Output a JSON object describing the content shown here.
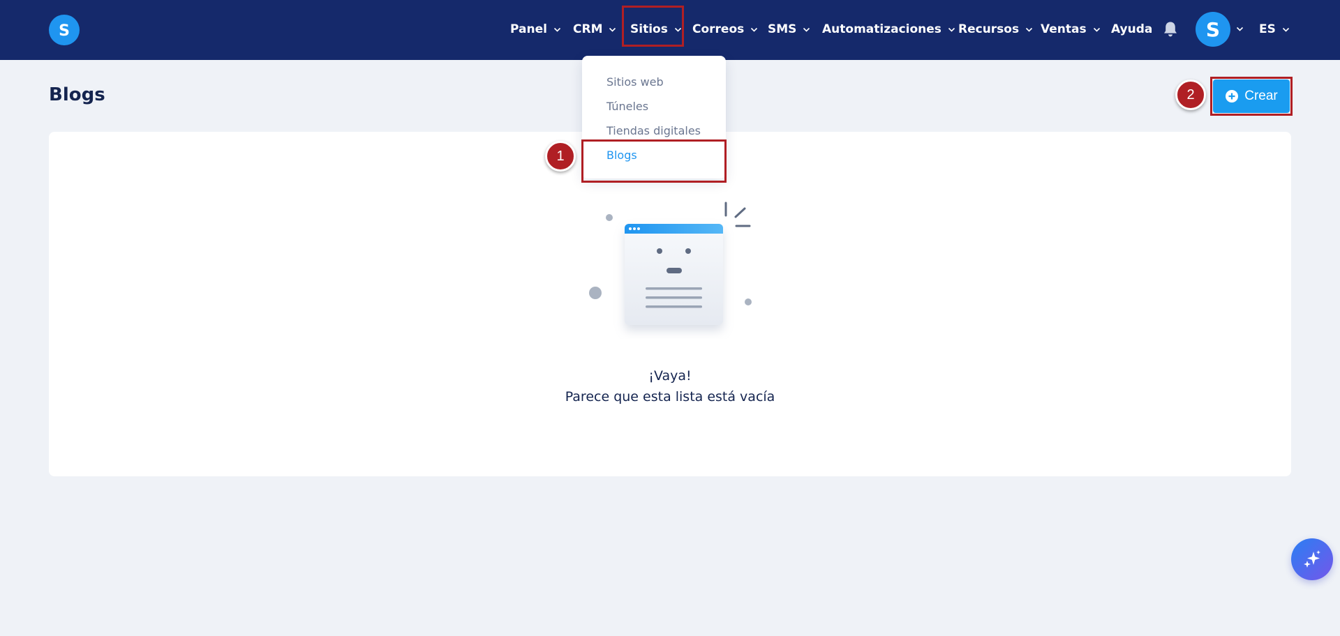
{
  "header": {
    "nav": [
      {
        "label": "Panel",
        "has_dropdown": true
      },
      {
        "label": "CRM",
        "has_dropdown": true
      },
      {
        "label": "Sitios",
        "has_dropdown": true,
        "open": true
      },
      {
        "label": "Correos",
        "has_dropdown": true
      },
      {
        "label": "SMS",
        "has_dropdown": true
      },
      {
        "label": "Automatizaciones",
        "has_dropdown": true
      },
      {
        "label": "Recursos",
        "has_dropdown": true
      },
      {
        "label": "Ventas",
        "has_dropdown": true
      },
      {
        "label": "Ayuda",
        "has_dropdown": false
      }
    ],
    "language": "ES",
    "icons": [
      "logo-s-icon",
      "bell-icon",
      "avatar-s-icon",
      "chevron-down-icon"
    ]
  },
  "sitios_menu": {
    "items": [
      {
        "label": "Sitios web",
        "active": false
      },
      {
        "label": "Túneles",
        "active": false
      },
      {
        "label": "Tiendas digitales",
        "active": false
      },
      {
        "label": "Blogs",
        "active": true
      }
    ]
  },
  "page": {
    "title": "Blogs",
    "create_label": "Crear"
  },
  "empty_state": {
    "title": "¡Vaya!",
    "message": "Parece que esta lista está vacía"
  },
  "annotations": {
    "step1": "1",
    "step2": "2",
    "color": "#b01f24"
  },
  "colors": {
    "header": "#15296b",
    "accent": "#1a9cf0",
    "background": "#eff2f7"
  }
}
